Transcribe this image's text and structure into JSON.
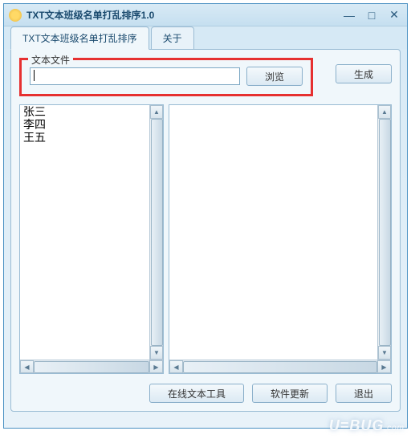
{
  "window": {
    "title": "TXT文本班级名单打乱排序1.0"
  },
  "tabs": {
    "main": "TXT文本班级名单打乱排序",
    "about": "关于"
  },
  "file": {
    "label": "文本文件",
    "value": "",
    "browse": "浏览",
    "generate": "生成"
  },
  "list_left": [
    "张三",
    "李四",
    "王五"
  ],
  "bottom": {
    "online_tool": "在线文本工具",
    "update": "软件更新",
    "exit": "退出"
  },
  "watermark": {
    "brand": "U=BUG",
    "suffix": ".com"
  }
}
